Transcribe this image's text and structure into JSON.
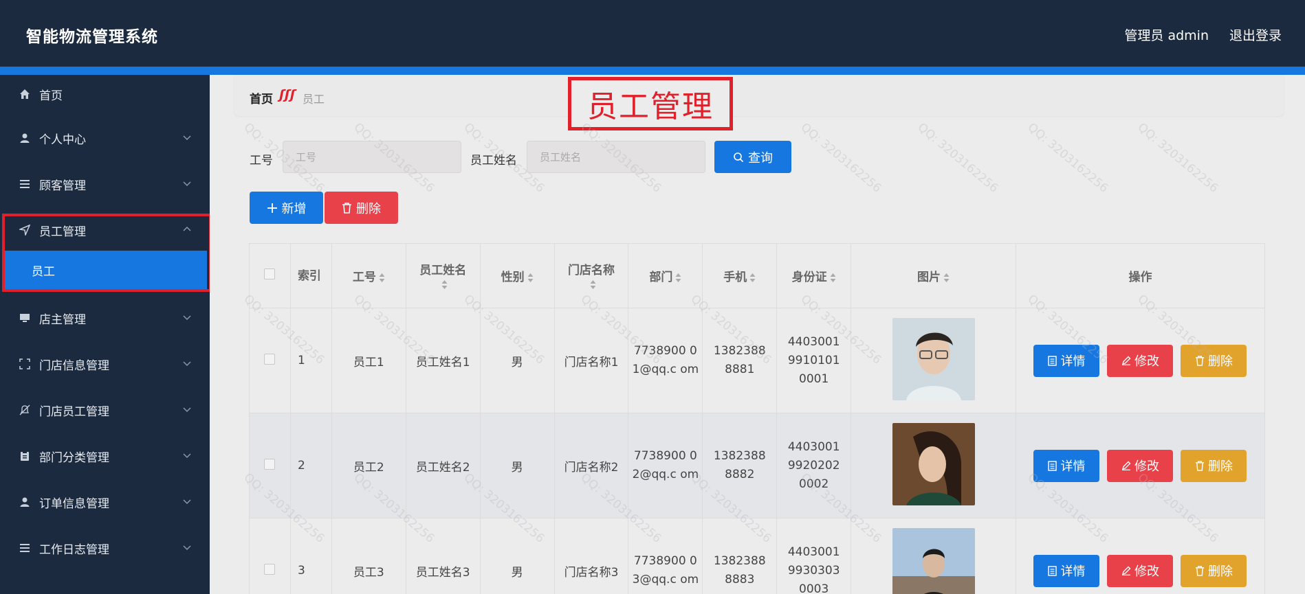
{
  "header": {
    "app_title": "智能物流管理系统",
    "user_label": "管理员 admin",
    "logout_label": "退出登录"
  },
  "sidebar": {
    "items": [
      {
        "label": "首页",
        "icon": "home-icon"
      },
      {
        "label": "个人中心",
        "icon": "user-icon"
      },
      {
        "label": "顾客管理",
        "icon": "list-icon"
      },
      {
        "label": "员工管理",
        "icon": "navigation-icon"
      },
      {
        "label": "店主管理",
        "icon": "monitor-icon"
      },
      {
        "label": "门店信息管理",
        "icon": "fullscreen-icon"
      },
      {
        "label": "门店员工管理",
        "icon": "bell-off-icon"
      },
      {
        "label": "部门分类管理",
        "icon": "clipboard-icon"
      },
      {
        "label": "订单信息管理",
        "icon": "user-icon"
      },
      {
        "label": "工作日志管理",
        "icon": "list-icon"
      }
    ],
    "active_sub": "员工"
  },
  "breadcrumb": {
    "home": "首页",
    "separator": "ʃʃʃ",
    "current": "员工"
  },
  "annotation_title": "员工管理",
  "search": {
    "emp_no_label": "工号",
    "emp_no_placeholder": "工号",
    "emp_name_label": "员工姓名",
    "emp_name_placeholder": "员工姓名",
    "query_label": "查询"
  },
  "actions": {
    "add_label": "新增",
    "delete_label": "删除"
  },
  "table": {
    "headers": [
      "索引",
      "工号",
      "员工姓名",
      "性别",
      "门店名称",
      "部门",
      "手机",
      "身份证",
      "图片",
      "操作"
    ],
    "rows": [
      {
        "index": "1",
        "emp_no": "员工1",
        "name": "员工姓名1",
        "gender": "男",
        "store": "门店名称1",
        "dept": "7738900 01@qq.c om",
        "phone": "1382388 8881",
        "id_card": "4403001 9910101 0001"
      },
      {
        "index": "2",
        "emp_no": "员工2",
        "name": "员工姓名2",
        "gender": "男",
        "store": "门店名称2",
        "dept": "7738900 02@qq.c om",
        "phone": "1382388 8882",
        "id_card": "4403001 9920202 0002"
      },
      {
        "index": "3",
        "emp_no": "员工3",
        "name": "员工姓名3",
        "gender": "男",
        "store": "门店名称3",
        "dept": "7738900 03@qq.c om",
        "phone": "1382388 8883",
        "id_card": "4403001 9930303 0003"
      }
    ],
    "op_detail": "详情",
    "op_edit": "修改",
    "op_delete": "删除"
  },
  "watermark": "QQ: 3203162256",
  "colors": {
    "header_bg": "#1b2a3e",
    "accent": "#1777e0",
    "danger": "#e8414a",
    "warning": "#e2a32c",
    "annotation": "#e0202a"
  }
}
